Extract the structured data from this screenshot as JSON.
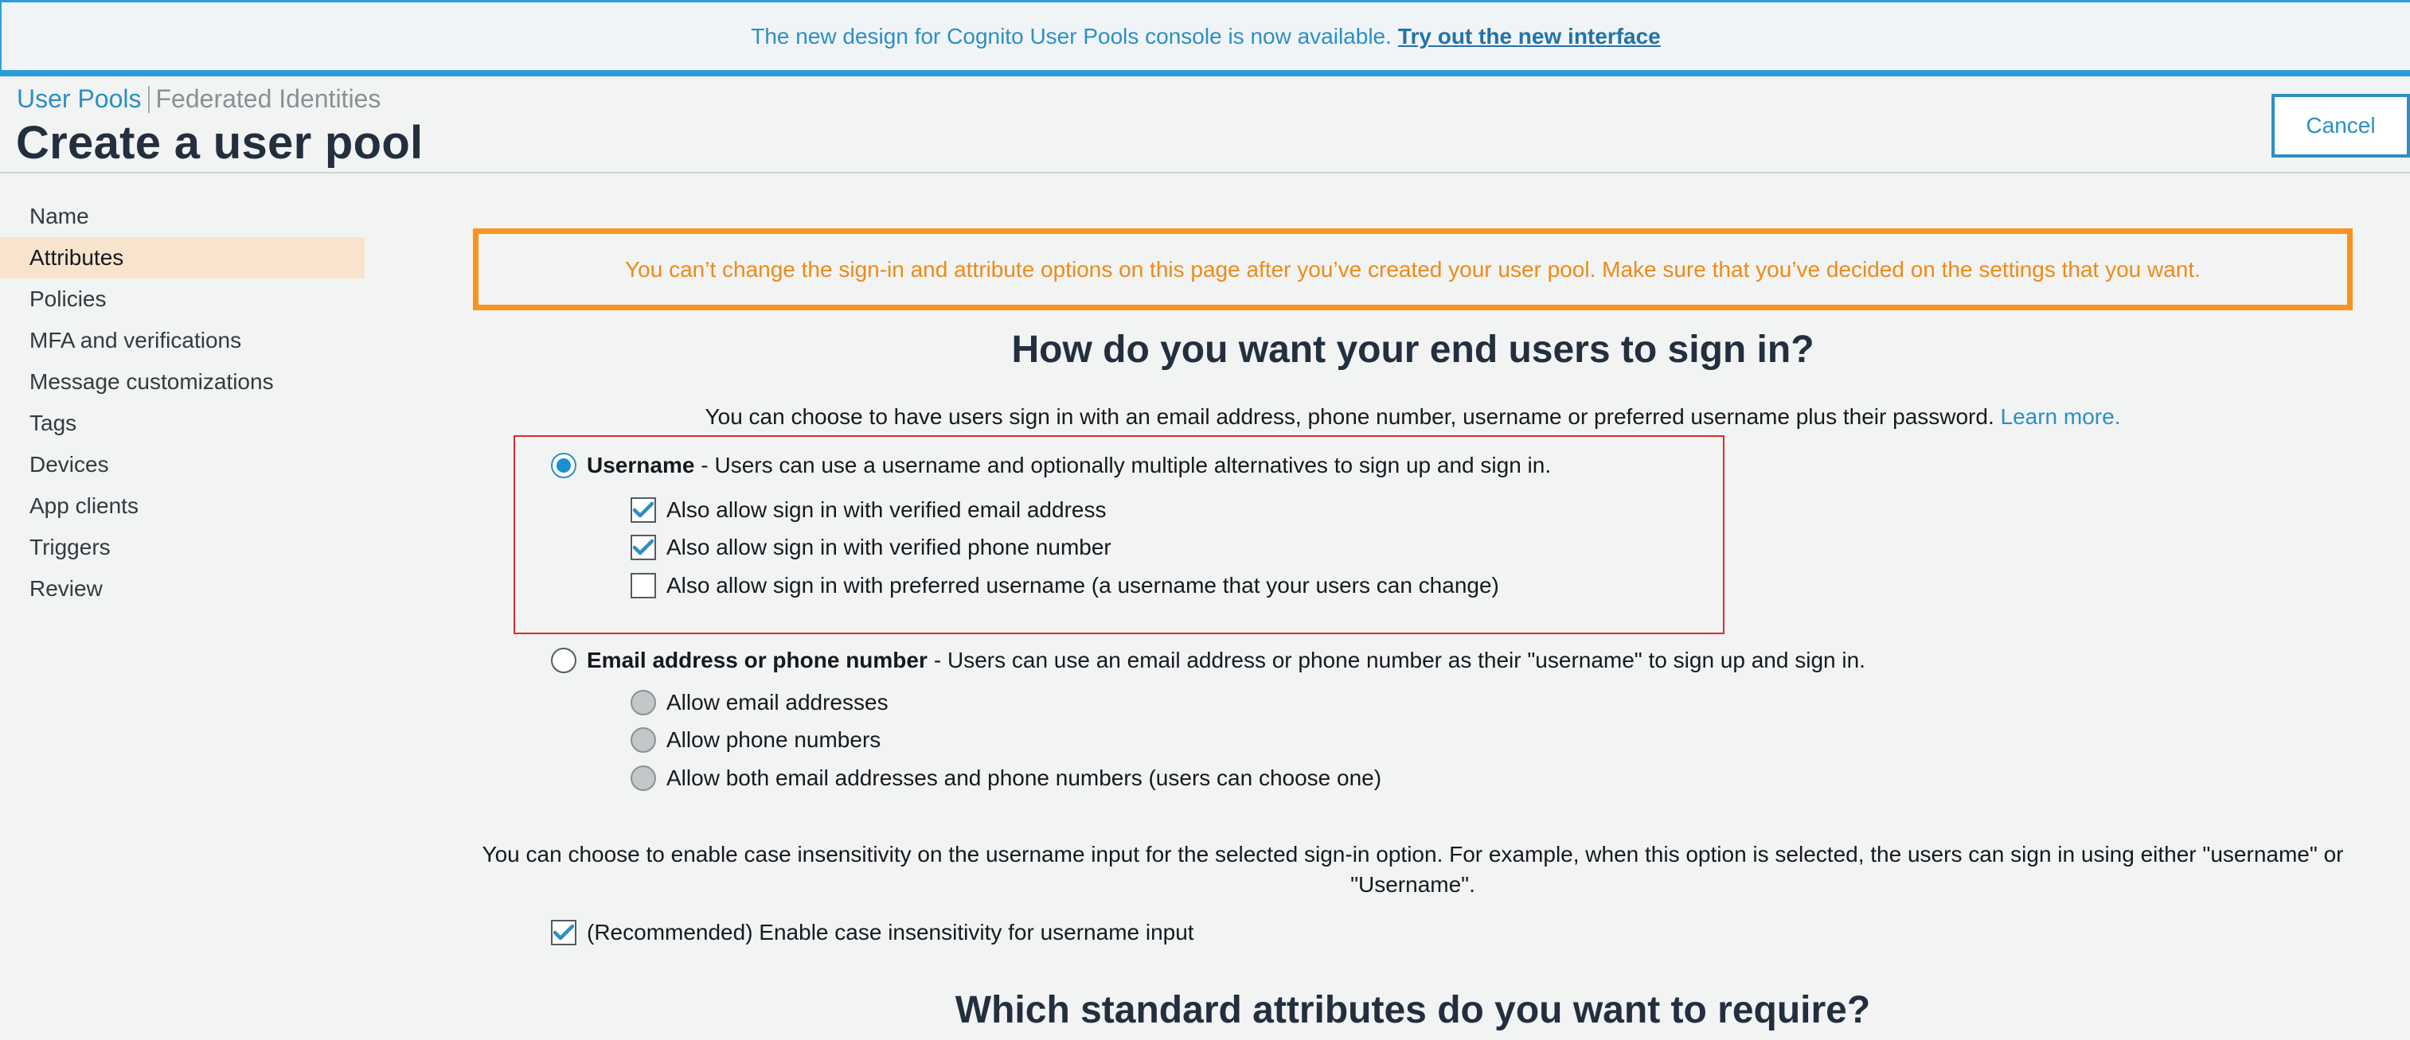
{
  "banner": {
    "message": "The new design for Cognito User Pools console is now available.",
    "link": "Try out the new interface"
  },
  "header": {
    "breadcrumb_user_pools": "User Pools",
    "breadcrumb_federated": "Federated Identities",
    "title": "Create a user pool",
    "cancel": "Cancel"
  },
  "sidebar": {
    "items": [
      {
        "label": "Name"
      },
      {
        "label": "Attributes"
      },
      {
        "label": "Policies"
      },
      {
        "label": "MFA and verifications"
      },
      {
        "label": "Message customizations"
      },
      {
        "label": "Tags"
      },
      {
        "label": "Devices"
      },
      {
        "label": "App clients"
      },
      {
        "label": "Triggers"
      },
      {
        "label": "Review"
      }
    ],
    "active": "Attributes"
  },
  "main": {
    "warning": "You can’t change the sign-in and attribute options on this page after you’ve created your user pool. Make sure that you’ve decided on the settings that you want.",
    "signin_heading": "How do you want your end users to sign in?",
    "signin_intro": "You can choose to have users sign in with an email address, phone number, username or preferred username plus their password.",
    "learn_more": "Learn more.",
    "username_option": {
      "title": "Username",
      "description": "- Users can use a username and optionally multiple alternatives to sign up and sign in.",
      "selected": true,
      "sub_options": [
        {
          "label": "Also allow sign in with verified email address",
          "checked": true
        },
        {
          "label": "Also allow sign in with verified phone number",
          "checked": true
        },
        {
          "label": "Also allow sign in with preferred username (a username that your users can change)",
          "checked": false
        }
      ]
    },
    "email_option": {
      "title": "Email address or phone number",
      "description": "- Users can use an email address or phone number as their \"username\" to sign up and sign in.",
      "selected": false,
      "sub_options": [
        {
          "label": "Allow email addresses"
        },
        {
          "label": "Allow phone numbers"
        },
        {
          "label": "Allow both email addresses and phone numbers (users can choose one)"
        }
      ]
    },
    "case_text_line1": "You can choose to enable case insensitivity on the username input for the selected sign-in option. For example, when this option is selected, the users can sign in using either \"username\" or",
    "case_text_line2": "\"Username\".",
    "case_checkbox": {
      "label": "(Recommended) Enable case insensitivity for username input",
      "checked": true
    },
    "attributes_heading": "Which standard attributes do you want to require?"
  },
  "colors": {
    "accent": "#2d8fc3",
    "warning": "#f7941e",
    "active_nav": "#f8e3cc",
    "highlight_box": "#e0282e"
  }
}
